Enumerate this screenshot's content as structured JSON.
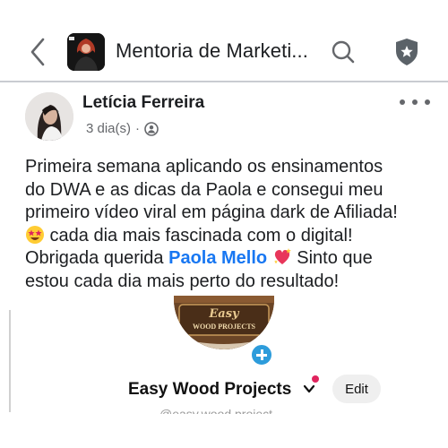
{
  "header": {
    "back_icon": "chevron-left-icon",
    "group_title": "Mentoria de Marketi...",
    "search_icon": "search-icon",
    "shield_icon": "shield-star-icon",
    "avatar_icon": "group-avatar-image"
  },
  "post": {
    "author": "Letícia Ferreira",
    "time": "3 dia(s)",
    "separator": "·",
    "privacy_icon": "members-icon",
    "more_icon": "more-horizontal-icon",
    "lines": [
      "Primeira semana aplicando os ensinamentos",
      "do DWA e as dicas da Paola e consegui meu",
      "primeiro vídeo viral em página dark de Afiliada!"
    ],
    "line4_emoji": "star-struck-emoji",
    "line4_text": " cada dia mais fascinada com o digital!",
    "line5_prefix": "Obrigada querida ",
    "mention": "Paola Mello",
    "line5_emoji": "sparkling-heart-emoji",
    "line5_suffix": " Sinto que",
    "line6": "estou cada dia mais perto do resultado!"
  },
  "embedded": {
    "logo_text_1": "Easy",
    "logo_text_2": "WOOD PROJECTS",
    "profile_name": "Easy Wood Projects",
    "edit_label": "Edit",
    "handle": "@easy.wood.project"
  },
  "colors": {
    "mention": "#1877f2",
    "secondary_text": "#65676b",
    "divider": "#c9ccd1",
    "plus_badge": "#2d9cdb",
    "notification_dot": "#e0245e"
  }
}
